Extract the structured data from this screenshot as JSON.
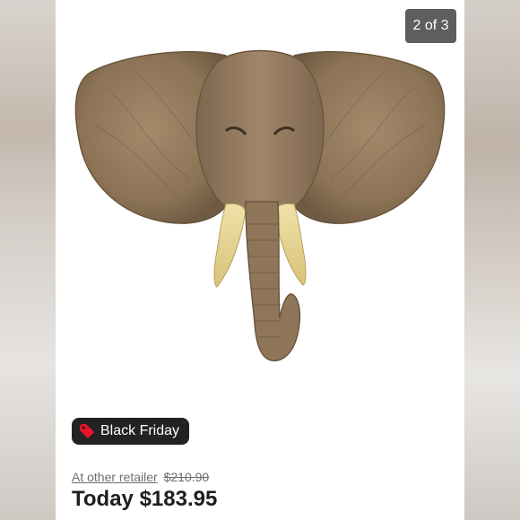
{
  "gallery": {
    "counter": "2 of 3",
    "image_subject": "elephant-head-wall-sculpture"
  },
  "promo": {
    "label": "Black Friday",
    "icon": "tag-icon",
    "icon_color": "#e8142a"
  },
  "pricing": {
    "other_retailer_label": "At other retailer",
    "other_retailer_price": "$210.90",
    "today_label": "Today",
    "today_price": "$183.95"
  },
  "colors": {
    "badge_bg": "#222222",
    "counter_bg": "#484848",
    "price_text": "#1e1e1e",
    "muted_text": "#6d6d6d"
  }
}
